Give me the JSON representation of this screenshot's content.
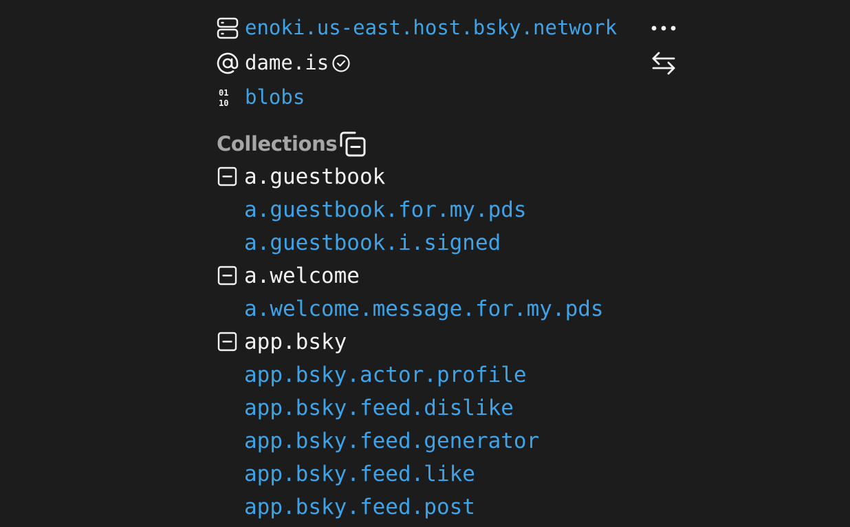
{
  "repo": {
    "pds_host": "enoki.us-east.host.bsky.network",
    "handle": "dame.is",
    "blobs_label": "blobs"
  },
  "icons": {
    "server": "server-icon",
    "at_sign": "at-sign-icon",
    "verified": "check-circle-icon",
    "binary": "binary-icon",
    "more": "more-horizontal-icon",
    "swap": "arrow-swap-icon",
    "collapse_all": "copy-minus-icon",
    "collapse_group": "minus-square-icon"
  },
  "collections": {
    "heading": "Collections",
    "groups": [
      {
        "name": "a.guestbook",
        "items": [
          "a.guestbook.for.my.pds",
          "a.guestbook.i.signed"
        ]
      },
      {
        "name": "a.welcome",
        "items": [
          "a.welcome.message.for.my.pds"
        ]
      },
      {
        "name": "app.bsky",
        "items": [
          "app.bsky.actor.profile",
          "app.bsky.feed.dislike",
          "app.bsky.feed.generator",
          "app.bsky.feed.like",
          "app.bsky.feed.post"
        ]
      }
    ]
  },
  "colors": {
    "background": "#1c1c1c",
    "link": "#3fa3e7",
    "text": "#f2f2f2",
    "muted": "#a6a6a6"
  }
}
